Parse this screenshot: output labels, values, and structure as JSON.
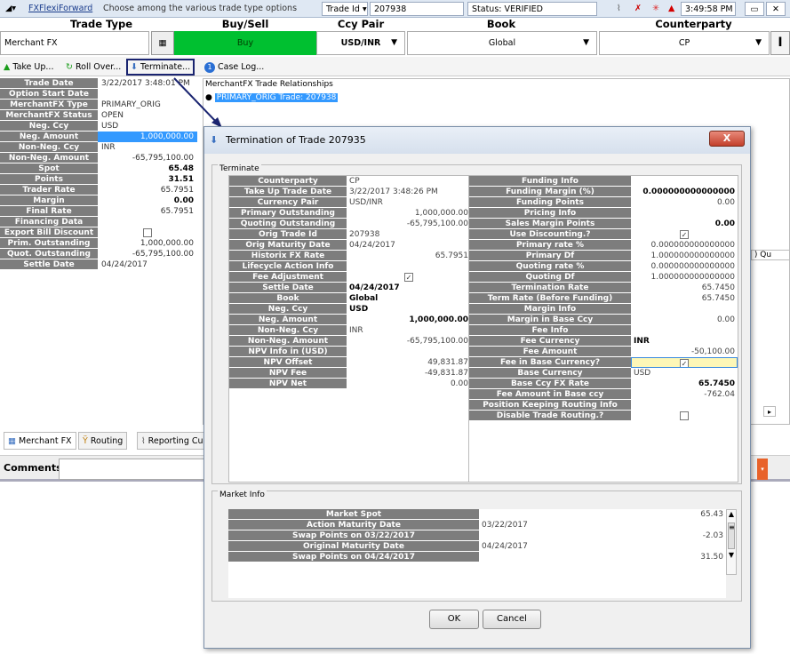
{
  "topbar": {
    "app_name": "FXFlexiForward",
    "hint": "Choose among the various trade type options",
    "search_field": "Trade Id",
    "trade_id": "207938",
    "status": "Status: VERIFIED",
    "clock": "3:49:58 PM"
  },
  "headers": {
    "trade_type": "Trade Type",
    "buy_sell": "Buy/Sell",
    "ccy_pair": "Ccy Pair",
    "book": "Book",
    "counterparty": "Counterparty"
  },
  "row2": {
    "trade_type": "Merchant FX",
    "buy_sell": "Buy",
    "ccy_pair": "USD/INR",
    "book": "Global",
    "counterparty": "CP",
    "colors": {
      "buy": "#00c030"
    }
  },
  "toolbar": {
    "take_up": "Take Up...",
    "roll_over": "Roll Over...",
    "terminate": "Terminate...",
    "case_log": "Case Log...",
    "case_count": "1"
  },
  "left_fields": [
    {
      "label": "Trade Date",
      "value": "3/22/2017 3:48:01 PM",
      "align": "l"
    },
    {
      "label": "Option Start Date",
      "value": "",
      "align": "l"
    },
    {
      "label": "MerchantFX Type",
      "value": "PRIMARY_ORIG",
      "align": "l"
    },
    {
      "label": "MerchantFX Status",
      "value": "OPEN",
      "align": "l"
    },
    {
      "label": "Neg. Ccy",
      "value": "USD",
      "align": "l"
    },
    {
      "label": "Neg. Amount",
      "value": "1,000,000.00",
      "align": "r",
      "sel": true
    },
    {
      "label": "Non-Neg. Ccy",
      "value": "INR",
      "align": "l"
    },
    {
      "label": "Non-Neg. Amount",
      "value": "-65,795,100.00",
      "align": "r"
    },
    {
      "label": "Spot",
      "value": "65.48",
      "align": "r",
      "bold": true
    },
    {
      "label": "Points",
      "value": "31.51",
      "align": "r",
      "bold": true
    },
    {
      "label": "Trader Rate",
      "value": "65.7951",
      "align": "r"
    },
    {
      "label": "Margin",
      "value": "0.00",
      "align": "r",
      "bold": true
    },
    {
      "label": "Final Rate",
      "value": "65.7951",
      "align": "r"
    },
    {
      "label": "Financing Data",
      "value": "",
      "align": "l"
    },
    {
      "label": "Export Bill Discount",
      "value": "",
      "align": "c",
      "check": true
    },
    {
      "label": "Prim. Outstanding",
      "value": "1,000,000.00",
      "align": "r"
    },
    {
      "label": "Quot. Outstanding",
      "value": "-65,795,100.00",
      "align": "r"
    },
    {
      "label": "Settle Date",
      "value": "04/24/2017",
      "align": "l"
    }
  ],
  "relationships": {
    "title": "MerchantFX Trade Relationships",
    "item": "PRIMARY_ORIG Trade: 207938"
  },
  "right_col_stub": "Qu",
  "tabs": {
    "merchant": "Merchant FX",
    "routing": "Routing",
    "reporting": "Reporting Cu"
  },
  "comments_label": "Comments",
  "dialog": {
    "title": "Termination of Trade 207935",
    "terminate_group": "Terminate",
    "left": [
      {
        "label": "Counterparty",
        "value": "CP",
        "align": "l"
      },
      {
        "label": "Take Up Trade Date",
        "value": "3/22/2017 3:48:26 PM",
        "align": "l"
      },
      {
        "label": "Currency Pair",
        "value": "USD/INR",
        "align": "l"
      },
      {
        "label": "Primary Outstanding",
        "value": "1,000,000.00",
        "align": "r"
      },
      {
        "label": "Quoting Outstanding",
        "value": "-65,795,100.00",
        "align": "r"
      },
      {
        "label": "Orig Trade Id",
        "value": "207938",
        "align": "l"
      },
      {
        "label": "Orig Maturity Date",
        "value": "04/24/2017",
        "align": "l"
      },
      {
        "label": "Historix FX Rate",
        "value": "65.7951",
        "align": "r"
      },
      {
        "label": "Lifecycle Action Info",
        "value": "",
        "align": "l"
      },
      {
        "label": "Fee Adjustment",
        "value": "",
        "align": "c",
        "check": "✓"
      },
      {
        "label": "Settle Date",
        "value": "04/24/2017",
        "align": "l",
        "bold": true
      },
      {
        "label": "Book",
        "value": "Global",
        "align": "l",
        "bold": true
      },
      {
        "label": "Neg. Ccy",
        "value": "USD",
        "align": "l",
        "bold": true
      },
      {
        "label": "Neg. Amount",
        "value": "1,000,000.00",
        "align": "r",
        "bold": true
      },
      {
        "label": "Non-Neg. Ccy",
        "value": "INR",
        "align": "l"
      },
      {
        "label": "Non-Neg. Amount",
        "value": "-65,795,100.00",
        "align": "r"
      },
      {
        "label": "NPV Info in (USD)",
        "value": "",
        "align": "l"
      },
      {
        "label": "NPV Offset",
        "value": "49,831.87",
        "align": "r"
      },
      {
        "label": "NPV Fee",
        "value": "-49,831.87",
        "align": "r"
      },
      {
        "label": "NPV Net",
        "value": "0.00",
        "align": "r"
      }
    ],
    "right": [
      {
        "label": "Funding Info",
        "value": "",
        "align": "l"
      },
      {
        "label": "Funding Margin (%)",
        "value": "0.000000000000000",
        "align": "r",
        "bold": true
      },
      {
        "label": "Funding Points",
        "value": "0.00",
        "align": "r"
      },
      {
        "label": "Pricing Info",
        "value": "",
        "align": "l"
      },
      {
        "label": "Sales Margin Points",
        "value": "0.00",
        "align": "r",
        "bold": true
      },
      {
        "label": "Use Discounting.?",
        "value": "",
        "align": "c",
        "check": "✓"
      },
      {
        "label": "Primary rate %",
        "value": "0.000000000000000",
        "align": "r"
      },
      {
        "label": "Primary Df",
        "value": "1.000000000000000",
        "align": "r"
      },
      {
        "label": "Quoting rate %",
        "value": "0.000000000000000",
        "align": "r"
      },
      {
        "label": "Quoting Df",
        "value": "1.000000000000000",
        "align": "r"
      },
      {
        "label": "Termination Rate",
        "value": "65.7450",
        "align": "r"
      },
      {
        "label": "Term Rate (Before Funding)",
        "value": "65.7450",
        "align": "r"
      },
      {
        "label": "Margin Info",
        "value": "",
        "align": "l"
      },
      {
        "label": "Margin in Base Ccy",
        "value": "0.00",
        "align": "r"
      },
      {
        "label": "Fee Info",
        "value": "",
        "align": "l"
      },
      {
        "label": "Fee Currency",
        "value": "INR",
        "align": "l",
        "bold": true
      },
      {
        "label": "Fee Amount",
        "value": "-50,100.00",
        "align": "r"
      },
      {
        "label": "Fee in Base Currency?",
        "value": "",
        "align": "c",
        "check": "✓",
        "hl": true
      },
      {
        "label": "Base Currency",
        "value": "USD",
        "align": "l"
      },
      {
        "label": "Base Ccy FX Rate",
        "value": "65.7450",
        "align": "r",
        "bold": true
      },
      {
        "label": "Fee Amount in Base ccy",
        "value": "-762.04",
        "align": "r"
      },
      {
        "label": "Position Keeping Routing Info",
        "value": "",
        "align": "l"
      },
      {
        "label": "Disable Trade Routing.?",
        "value": "",
        "align": "c",
        "check": ""
      }
    ],
    "market_group": "Market Info",
    "market": [
      {
        "label": "Market Spot",
        "value": "65.43",
        "align": "r"
      },
      {
        "label": "Action Maturity Date",
        "value": "03/22/2017",
        "align": "l"
      },
      {
        "label": "Swap Points on 03/22/2017",
        "value": "-2.03",
        "align": "r"
      },
      {
        "label": "Original Maturity Date",
        "value": "04/24/2017",
        "align": "l"
      },
      {
        "label": "Swap Points on 04/24/2017",
        "value": "31.50",
        "align": "r"
      }
    ],
    "ok": "OK",
    "cancel": "Cancel"
  }
}
